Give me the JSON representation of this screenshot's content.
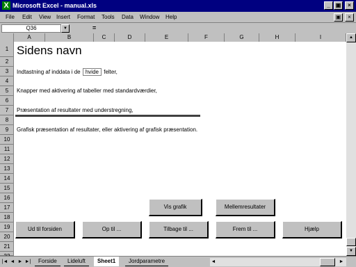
{
  "window": {
    "title": "Microsoft Excel - manual.xls",
    "app_icon": "excel-x-icon",
    "controls": {
      "minimize": "_",
      "maximize": "▣",
      "close": "×"
    }
  },
  "menubar": {
    "items": [
      "File",
      "Edit",
      "View",
      "Insert",
      "Format",
      "Tools",
      "Data",
      "Window",
      "Help"
    ],
    "doc_controls": {
      "restore": "▣",
      "close": "×"
    }
  },
  "formulabar": {
    "cell_ref": "Q36",
    "dropdown_icon": "▼",
    "equals": "=",
    "formula": ""
  },
  "grid": {
    "corner": "",
    "columns": [
      "A",
      "B",
      "C",
      "D",
      "E",
      "F",
      "G",
      "H",
      "I"
    ],
    "rows": [
      "1",
      "2",
      "3",
      "4",
      "5",
      "6",
      "7",
      "8",
      "9",
      "10",
      "11",
      "12",
      "13",
      "14",
      "15",
      "16",
      "17",
      "18",
      "19",
      "20",
      "21",
      "22"
    ]
  },
  "sheet": {
    "heading": "Sidens navn",
    "line3_prefix": "Indtastning af inddata i de",
    "line3_highlight": "hvide",
    "line3_suffix": "felter,",
    "line5": "Knapper med aktivering af tabeller med standardværdier,",
    "line7": "Præsentation af resultater med understregning,",
    "line9": "Grafisk præsentation af resultater, eller aktivering af grafisk præsentation."
  },
  "buttons": {
    "vis_grafik": "Vis grafik",
    "mellemresultater": "Mellemresultater",
    "ud_til_forsiden": "Ud til forsiden",
    "op_til": "Op til ...",
    "tilbage_til": "Tilbage til ...",
    "frem_til": "Frem til ...",
    "hjaelp": "Hjælp"
  },
  "scrollbar": {
    "up": "▲",
    "down": "▼",
    "left": "◄",
    "right": "►"
  },
  "tabs": {
    "nav": [
      "|◄",
      "◄",
      "►",
      "►|"
    ],
    "sheets": [
      "Forside",
      "Lideluft",
      "Sheet1",
      "Jordparametre"
    ],
    "active_index": 2
  },
  "colors": {
    "titlebar": "#000080",
    "chrome": "#c0c0c0",
    "sheet": "#ffffff"
  }
}
